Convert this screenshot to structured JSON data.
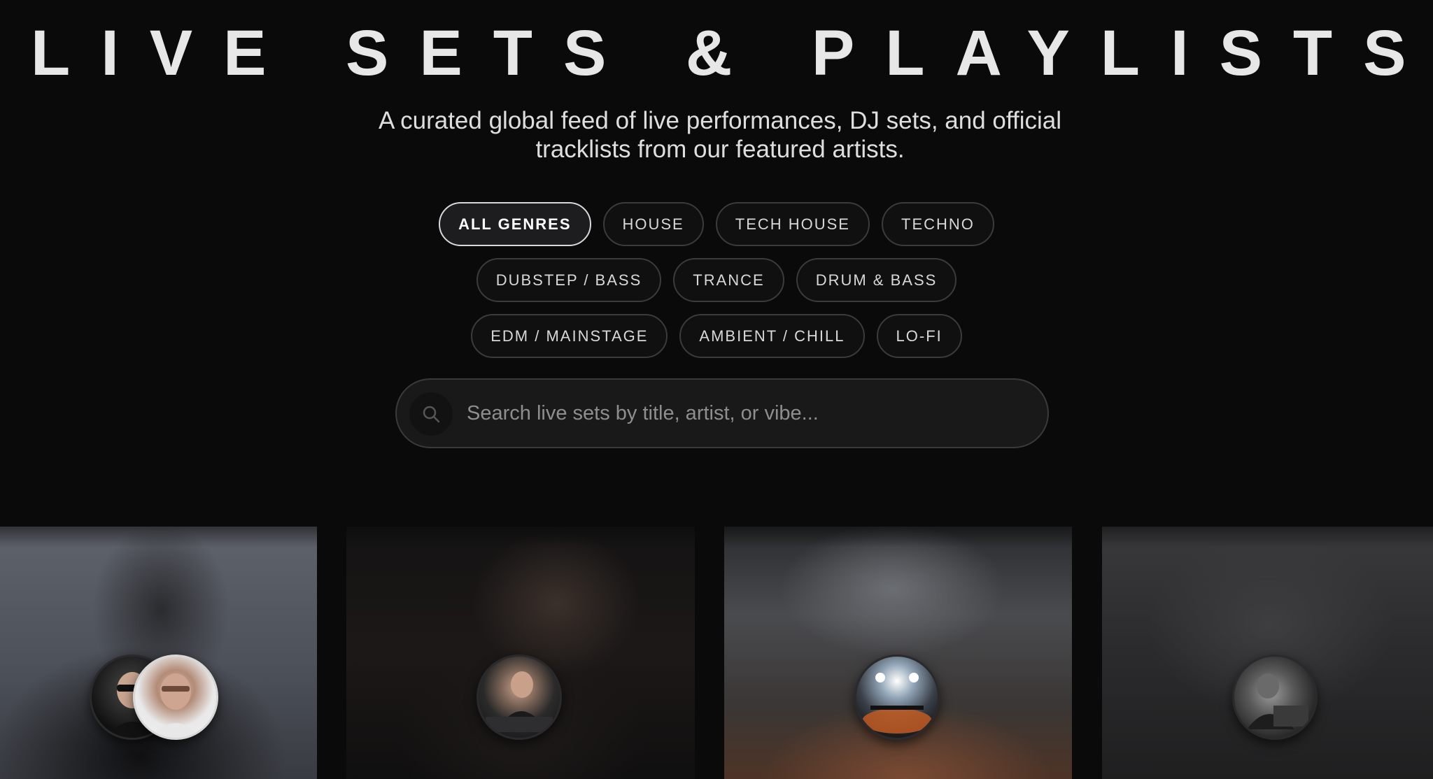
{
  "header": {
    "title": "LIVE SETS & PLAYLISTS",
    "subtitle": "A curated global feed of live performances, DJ sets, and official tracklists from our featured artists."
  },
  "genres": {
    "row1": [
      "ALL GENRES",
      "HOUSE",
      "TECH HOUSE",
      "TECHNO"
    ],
    "row2": [
      "DUBSTEP / BASS",
      "TRANCE",
      "DRUM & BASS"
    ],
    "row3": [
      "EDM / MAINSTAGE",
      "AMBIENT / CHILL",
      "LO-FI"
    ],
    "active": "ALL GENRES"
  },
  "search": {
    "placeholder": "Search live sets by title, artist, or vibe...",
    "value": ""
  },
  "cards": [
    {
      "avatars": 2,
      "icon": "artist-duo-avatar"
    },
    {
      "avatars": 1,
      "icon": "dj-avatar"
    },
    {
      "avatars": 1,
      "icon": "concert-stage-avatar"
    },
    {
      "avatars": 1,
      "icon": "dj-booth-avatar"
    }
  ],
  "colors": {
    "background": "#0a0a0b",
    "chip_border": "#3b3b3d",
    "chip_active_border": "#d9d9d9",
    "text": "#e6e6e6"
  }
}
